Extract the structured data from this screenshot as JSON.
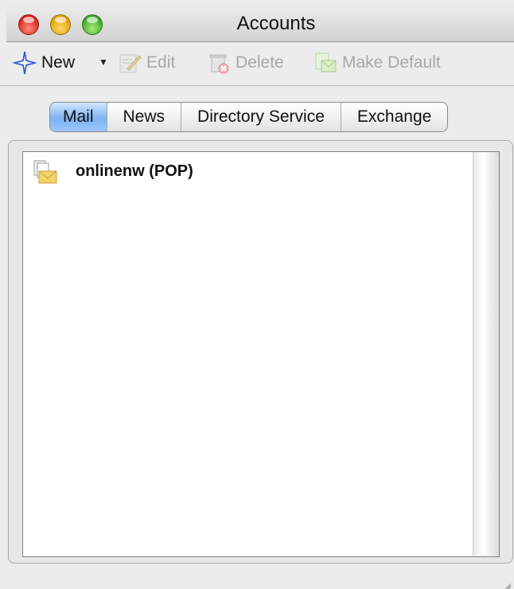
{
  "window": {
    "title": "Accounts"
  },
  "toolbar": {
    "new_label": "New",
    "edit_label": "Edit",
    "delete_label": "Delete",
    "make_default_label": "Make Default"
  },
  "tabs": [
    {
      "label": "Mail",
      "active": true
    },
    {
      "label": "News",
      "active": false
    },
    {
      "label": "Directory Service",
      "active": false
    },
    {
      "label": "Exchange",
      "active": false
    }
  ],
  "accounts": [
    {
      "label": "onlinenw (POP)",
      "icon": "mail-account-icon"
    }
  ],
  "colors": {
    "active_tab": "#7eb3f2",
    "disabled_text": "#a8a8a8"
  }
}
